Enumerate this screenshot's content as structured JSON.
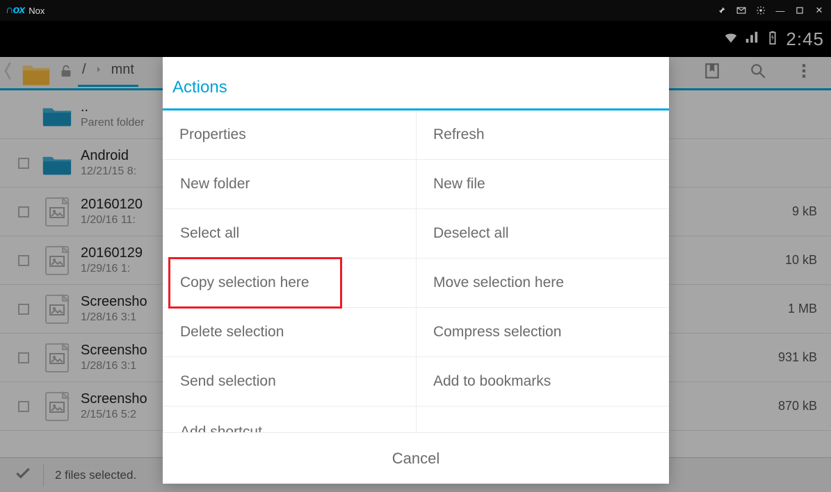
{
  "window": {
    "app_name": "Nox"
  },
  "status": {
    "clock": "2:45"
  },
  "breadcrumb": {
    "root": "/",
    "segment": "mnt"
  },
  "files": [
    {
      "name": "..",
      "sub": "Parent folder",
      "size": "",
      "type": "parent"
    },
    {
      "name": "Android",
      "sub": "12/21/15 8:",
      "size": "",
      "type": "folder"
    },
    {
      "name": "20160120",
      "sub": "1/20/16 11:",
      "size": "9 kB",
      "type": "image"
    },
    {
      "name": "20160129",
      "sub": "1/29/16 1:",
      "size": "10 kB",
      "type": "image"
    },
    {
      "name": "Screensho",
      "sub": "1/28/16 3:1",
      "size": "1 MB",
      "type": "image"
    },
    {
      "name": "Screensho",
      "sub": "1/28/16 3:1",
      "size": "931 kB",
      "type": "image"
    },
    {
      "name": "Screensho",
      "sub": "2/15/16 5:2",
      "size": "870 kB",
      "type": "image"
    }
  ],
  "bottombar": {
    "text": "2 files selected."
  },
  "dialog": {
    "title": "Actions",
    "actions": [
      [
        "Properties",
        "Refresh"
      ],
      [
        "New folder",
        "New file"
      ],
      [
        "Select all",
        "Deselect all"
      ],
      [
        "Copy selection here",
        "Move selection here"
      ],
      [
        "Delete selection",
        "Compress selection"
      ],
      [
        "Send selection",
        "Add to bookmarks"
      ],
      [
        "Add shortcut",
        ""
      ]
    ],
    "cancel": "Cancel",
    "highlighted_index_row": 3,
    "highlighted_index_col": 0
  }
}
